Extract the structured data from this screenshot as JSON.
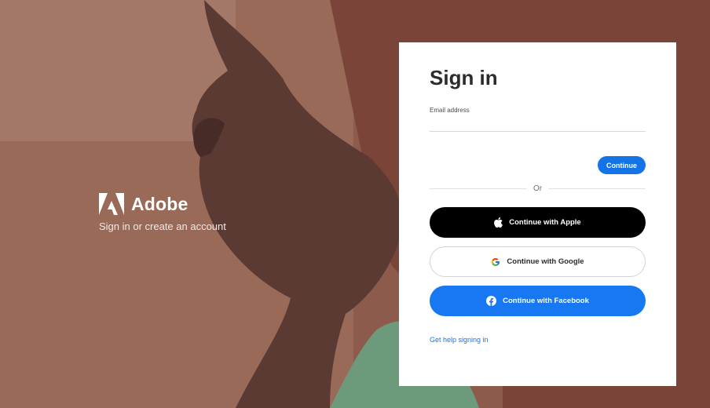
{
  "brand": {
    "name": "Adobe",
    "tagline": "Sign in or create an account",
    "logo_icon": "adobe-logo-icon"
  },
  "signin": {
    "title": "Sign in",
    "email_label": "Email address",
    "email_value": "",
    "continue_label": "Continue",
    "divider_text": "Or",
    "apple_label": "Continue with Apple",
    "google_label": "Continue with Google",
    "facebook_label": "Continue with Facebook",
    "help_link": "Get help signing in"
  },
  "colors": {
    "accent": "#1473e6",
    "facebook": "#1877f2",
    "apple": "#000000"
  }
}
